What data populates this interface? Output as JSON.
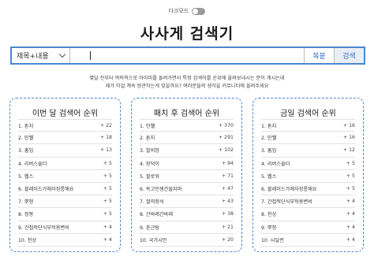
{
  "header": {
    "dark_mode_label": "다크모드",
    "title": "사사게 검색기"
  },
  "search": {
    "select_value": "제목+내용",
    "input_value": "",
    "paste_label": "복붙",
    "search_label": "검색"
  },
  "description": {
    "line1": "몇달 전부터 떡의적으로 아이피를 돌려가면서 특정 검색어를 순위에 올려보내시는 분이 계시는데",
    "line2": "제가 이걸 계속 방관하는게 맞을까요? 여러분들의 생각을 커뮤니티에 올려주세요"
  },
  "panels": [
    {
      "title": "이번 달 검색어 순위",
      "rows": [
        {
          "label": "1. 톤지",
          "count": "+ 22"
        },
        {
          "label": "2. 민웰",
          "count": "+ 18"
        },
        {
          "label": "3. 홈입",
          "count": "+ 13"
        },
        {
          "label": "4. 리버스숄더",
          "count": "+ 5"
        },
        {
          "label": "5. 웹스",
          "count": "+ 5"
        },
        {
          "label": "6. 블레이드가해자징릉해요",
          "count": "+ 5"
        },
        {
          "label": "7. 뿌청",
          "count": "+ 5"
        },
        {
          "label": "8. 정봉",
          "count": "+ 5"
        },
        {
          "label": "9. 간첩적단식부작용변비",
          "count": "+ 4"
        },
        {
          "label": "10. 천상",
          "count": "+ 4"
        }
      ]
    },
    {
      "title": "패치 후 검색어 순위",
      "rows": [
        {
          "label": "1. 민웰",
          "count": "+ 370"
        },
        {
          "label": "2. 톤지",
          "count": "+ 291"
        },
        {
          "label": "3. 힐비앙",
          "count": "+ 102"
        },
        {
          "label": "4. 장덕이",
          "count": "+ 94"
        },
        {
          "label": "5. 팔로워",
          "count": "+ 71"
        },
        {
          "label": "6. 독고민생간들지마",
          "count": "+ 47"
        },
        {
          "label": "7. 절의정석",
          "count": "+ 43"
        },
        {
          "label": "8. 간바레간바레",
          "count": "+ 38"
        },
        {
          "label": "9. 혼근탐",
          "count": "+ 21"
        },
        {
          "label": "10. 국가시민",
          "count": "+ 20"
        }
      ]
    },
    {
      "title": "금일 검색어 순위",
      "rows": [
        {
          "label": "1. 톤지",
          "count": "+ 16"
        },
        {
          "label": "2. 민웰",
          "count": "+ 16"
        },
        {
          "label": "3. 홈입",
          "count": "+ 12"
        },
        {
          "label": "4. 리버스숄더",
          "count": "+ 5"
        },
        {
          "label": "5. 웹스",
          "count": "+ 5"
        },
        {
          "label": "6. 블레이드가해자징릉해요",
          "count": "+ 5"
        },
        {
          "label": "7. 간첩적단식부작용변비",
          "count": "+ 4"
        },
        {
          "label": "8. 천상",
          "count": "+ 4"
        },
        {
          "label": "9. 뿌청",
          "count": "+ 4"
        },
        {
          "label": "10. 시달런",
          "count": "+ 4"
        }
      ]
    }
  ]
}
